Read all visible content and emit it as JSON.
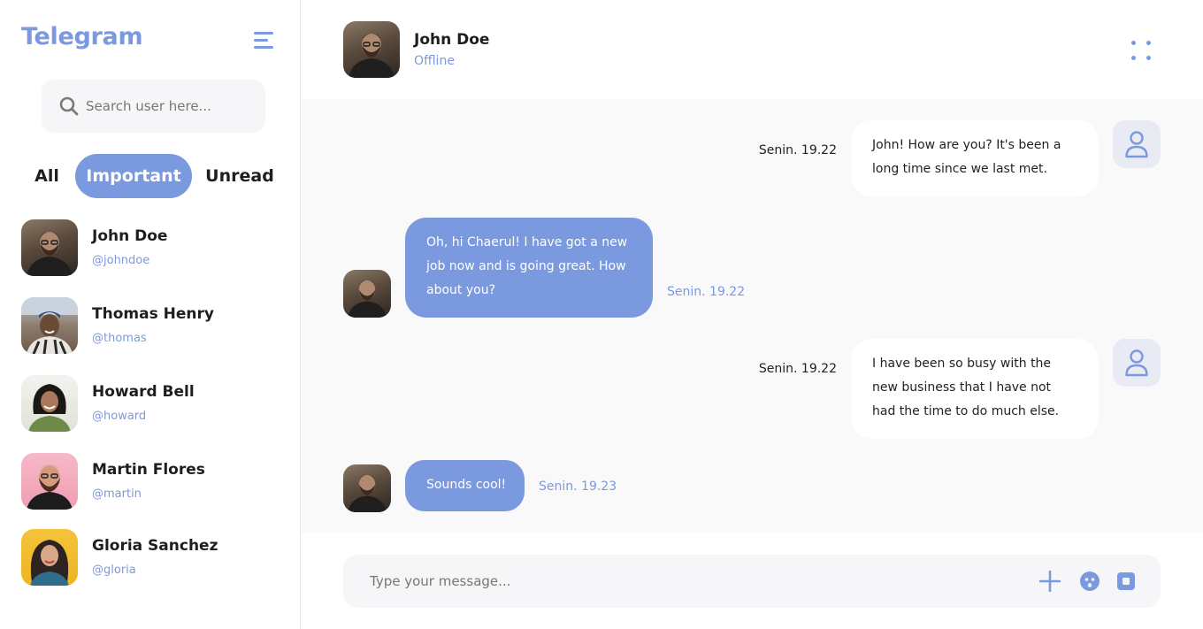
{
  "app": {
    "title": "Telegram"
  },
  "search": {
    "placeholder": "Search user here..."
  },
  "filters": [
    {
      "label": "All",
      "active": false
    },
    {
      "label": "Important",
      "active": true
    },
    {
      "label": "Unread",
      "active": false
    }
  ],
  "contacts": [
    {
      "name": "John Doe",
      "handle": "@johndoe"
    },
    {
      "name": "Thomas Henry",
      "handle": "@thomas"
    },
    {
      "name": "Howard Bell",
      "handle": "@howard"
    },
    {
      "name": "Martin Flores",
      "handle": "@martin"
    },
    {
      "name": "Gloria Sanchez",
      "handle": "@gloria"
    }
  ],
  "chat": {
    "name": "John Doe",
    "status": "Offline",
    "messages": [
      {
        "direction": "outgoing",
        "text": "John! How are you? It's been a long time since we last met.",
        "time": "Senin. 19.22"
      },
      {
        "direction": "incoming",
        "text": "Oh, hi Chaerul! I have got a new job now and is going great. How about you?",
        "time": "Senin. 19.22"
      },
      {
        "direction": "outgoing",
        "text": "I have been so busy with the new business that I have not had the time to do much else.",
        "time": "Senin. 19.22"
      },
      {
        "direction": "incoming",
        "text": "Sounds cool!",
        "time": "Senin. 19.23"
      }
    ]
  },
  "composer": {
    "placeholder": "Type your message..."
  },
  "colors": {
    "accent": "#7b99df",
    "background": "#f9f9f9",
    "text": "#1e1e1e"
  },
  "icons": [
    "menu-icon",
    "search-icon",
    "more-icon",
    "user-icon",
    "plus-icon",
    "emoji-icon",
    "stop-icon"
  ]
}
